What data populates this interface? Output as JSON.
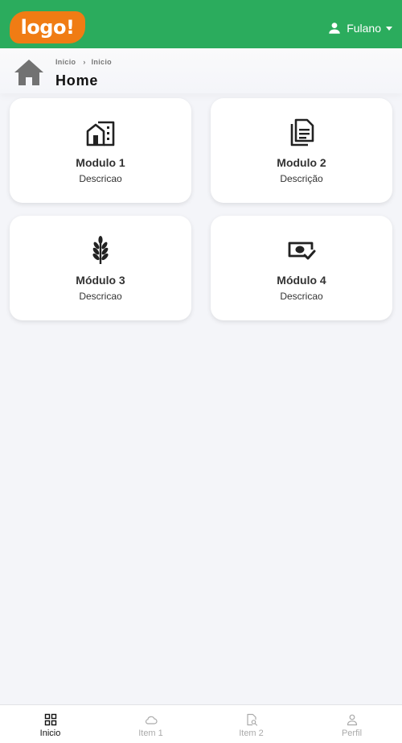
{
  "topbar": {
    "logo_text": "logo!",
    "user_name": "Fulano",
    "colors": {
      "bar": "#2bac5d",
      "logo": "#f07c14"
    }
  },
  "header": {
    "breadcrumb": [
      "Inicio",
      "Inicio"
    ],
    "title": "Home"
  },
  "modules": [
    {
      "title": "Modulo 1",
      "description": "Descricao",
      "icon": "building-icon"
    },
    {
      "title": "Modulo 2",
      "description": "Descrição",
      "icon": "document-icon"
    },
    {
      "title": "Módulo 3",
      "description": "Descricao",
      "icon": "wheat-icon"
    },
    {
      "title": "Módulo 4",
      "description": "Descricao",
      "icon": "money-check-icon"
    }
  ],
  "bottom_nav": [
    {
      "label": "Inicio",
      "icon": "grid-icon",
      "active": true
    },
    {
      "label": "Item 1",
      "icon": "cloud-icon",
      "active": false
    },
    {
      "label": "Item 2",
      "icon": "file-search-icon",
      "active": false
    },
    {
      "label": "Perfil",
      "icon": "person-icon",
      "active": false
    }
  ]
}
